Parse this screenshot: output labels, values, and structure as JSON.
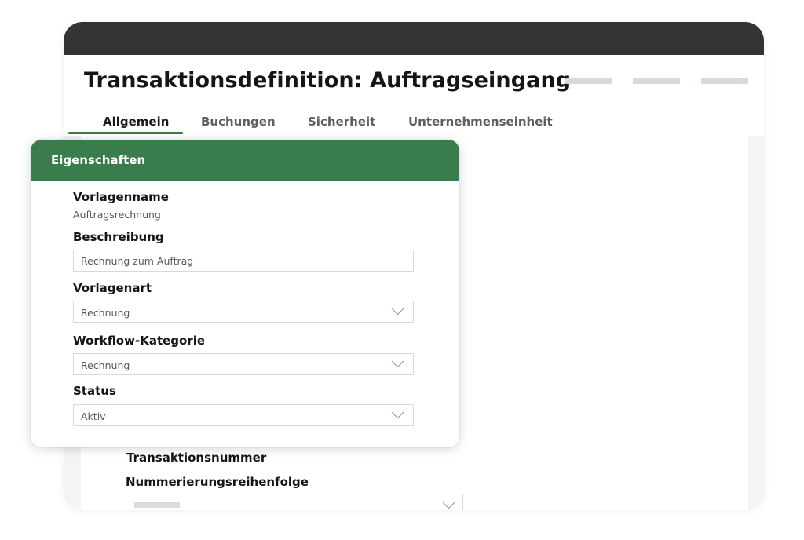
{
  "window": {
    "title": "Transaktionsdefinition: Auftragseingang",
    "tabs": [
      {
        "label": "Allgemein",
        "active": true
      },
      {
        "label": "Buchungen",
        "active": false
      },
      {
        "label": "Sicherheit",
        "active": false
      },
      {
        "label": "Unternehmenseinheit",
        "active": false
      }
    ]
  },
  "background_form": {
    "transaction_number_label": "Transaktionsnummer",
    "numbering_order_label": "Nummerierungsreihenfolge"
  },
  "panel": {
    "title": "Eigenschaften",
    "template_name_label": "Vorlagenname",
    "template_name_value": "Auftragsrechnung",
    "description_label": "Beschreibung",
    "description_value": "Rechnung zum Auftrag",
    "template_type_label": "Vorlagenart",
    "template_type_value": "Rechnung",
    "workflow_category_label": "Workflow-Kategorie",
    "workflow_category_value": "Rechnung",
    "status_label": "Status",
    "status_value": "Aktiv"
  },
  "colors": {
    "accent": "#3a7d4c",
    "titlebar": "#333333"
  }
}
